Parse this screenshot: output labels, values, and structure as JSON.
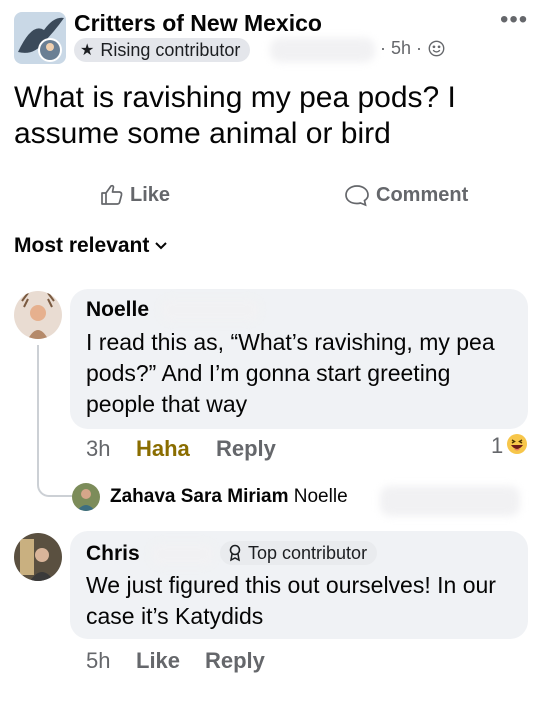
{
  "post": {
    "group_name": "Critters of New Mexico",
    "badge": "Rising contributor",
    "time": "· 5h ·",
    "more": "•••",
    "text": "What is ravishing my pea pods? I assume some animal or bird",
    "like_label": "Like",
    "comment_label": "Comment"
  },
  "sort_label": "Most relevant",
  "comments": [
    {
      "name": "Noelle",
      "text": "I read this as, “What’s ravishing, my pea pods?” And I’m gonna start greeting people that way",
      "time": "3h",
      "reaction": "Haha",
      "reply": "Reply",
      "reaction_count": "1"
    },
    {
      "reply_name": "Zahava Sara Miriam",
      "reply_tag": "Noelle"
    },
    {
      "name": "Chris",
      "badge": "Top contributor",
      "text": "We just figured this out ourselves! In our case it’s Katydids",
      "time": "5h",
      "like": "Like",
      "reply": "Reply"
    }
  ],
  "colors": {
    "haha": "#8a6d00",
    "secondary": "#65676b",
    "bubble": "#f0f2f5"
  }
}
